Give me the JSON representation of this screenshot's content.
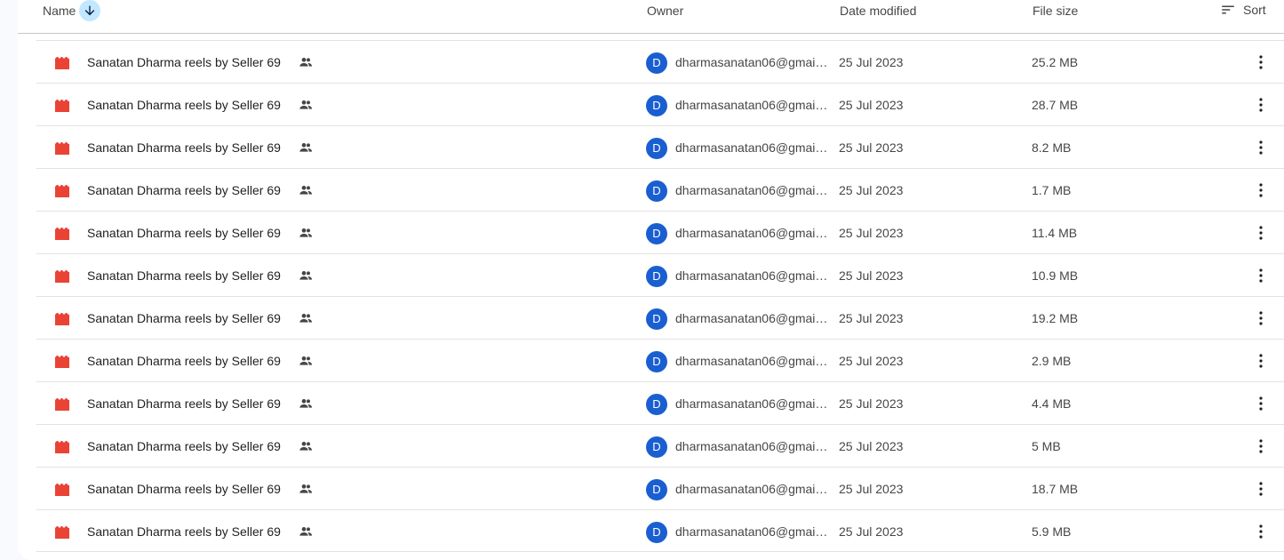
{
  "header": {
    "name": "Name",
    "owner": "Owner",
    "date_modified": "Date modified",
    "file_size": "File size",
    "sort": "Sort"
  },
  "colors": {
    "accent": "#c2e7ff",
    "avatar": "#1a5fd1",
    "file_icon": "#ea4335"
  },
  "icons": {
    "file": "video-file-icon",
    "shared": "shared-people-icon",
    "more": "more-vert-icon",
    "sort_direction": "arrow-down-icon",
    "sort": "sort-lines-icon"
  },
  "files": [
    {
      "name": "Sanatan Dharma reels by Seller 69",
      "avatar": "D",
      "owner": "dharmasanatan06@gmail.com",
      "date": "25 Jul 2023",
      "size": "25.2 MB"
    },
    {
      "name": "Sanatan Dharma reels by Seller 69",
      "avatar": "D",
      "owner": "dharmasanatan06@gmail.com",
      "date": "25 Jul 2023",
      "size": "28.7 MB"
    },
    {
      "name": "Sanatan Dharma reels by Seller 69",
      "avatar": "D",
      "owner": "dharmasanatan06@gmail.com",
      "date": "25 Jul 2023",
      "size": "8.2 MB"
    },
    {
      "name": "Sanatan Dharma reels by Seller 69",
      "avatar": "D",
      "owner": "dharmasanatan06@gmail.com",
      "date": "25 Jul 2023",
      "size": "1.7 MB"
    },
    {
      "name": "Sanatan Dharma reels by Seller 69",
      "avatar": "D",
      "owner": "dharmasanatan06@gmail.com",
      "date": "25 Jul 2023",
      "size": "11.4 MB"
    },
    {
      "name": "Sanatan Dharma reels by Seller 69",
      "avatar": "D",
      "owner": "dharmasanatan06@gmail.com",
      "date": "25 Jul 2023",
      "size": "10.9 MB"
    },
    {
      "name": "Sanatan Dharma reels by Seller 69",
      "avatar": "D",
      "owner": "dharmasanatan06@gmail.com",
      "date": "25 Jul 2023",
      "size": "19.2 MB"
    },
    {
      "name": "Sanatan Dharma reels by Seller 69",
      "avatar": "D",
      "owner": "dharmasanatan06@gmail.com",
      "date": "25 Jul 2023",
      "size": "2.9 MB"
    },
    {
      "name": "Sanatan Dharma reels by Seller 69",
      "avatar": "D",
      "owner": "dharmasanatan06@gmail.com",
      "date": "25 Jul 2023",
      "size": "4.4 MB"
    },
    {
      "name": "Sanatan Dharma reels by Seller 69",
      "avatar": "D",
      "owner": "dharmasanatan06@gmail.com",
      "date": "25 Jul 2023",
      "size": "5 MB"
    },
    {
      "name": "Sanatan Dharma reels by Seller 69",
      "avatar": "D",
      "owner": "dharmasanatan06@gmail.com",
      "date": "25 Jul 2023",
      "size": "18.7 MB"
    },
    {
      "name": "Sanatan Dharma reels by Seller 69",
      "avatar": "D",
      "owner": "dharmasanatan06@gmail.com",
      "date": "25 Jul 2023",
      "size": "5.9 MB"
    }
  ]
}
